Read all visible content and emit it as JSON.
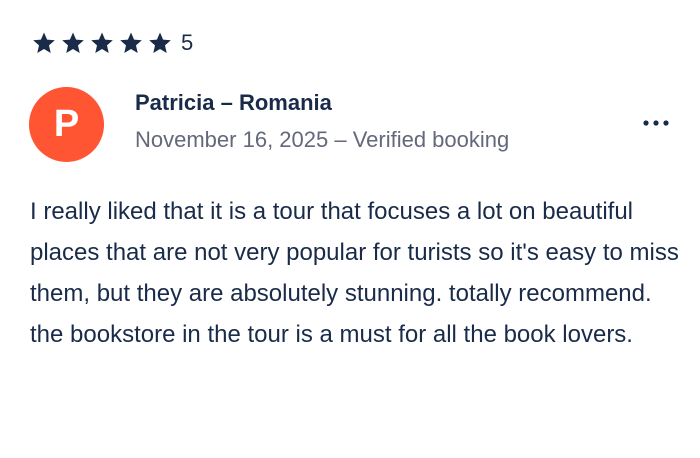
{
  "rating": {
    "stars": 5,
    "max_stars": 5,
    "value_label": "5",
    "star_color": "#1a2b49"
  },
  "reviewer": {
    "avatar_initial": "P",
    "avatar_color": "#ff5533",
    "name": "Patricia – Romania",
    "meta": "November 16, 2025 – Verified booking"
  },
  "menu": {
    "icon": "more-horizontal-icon"
  },
  "review": {
    "text": "I really liked that it is a tour that focuses a lot on beautiful places that are not very popular for turists so it's easy to miss them, but they are absolutely stunning. totally recommend. the bookstore in the tour is a must for all the book lovers."
  }
}
